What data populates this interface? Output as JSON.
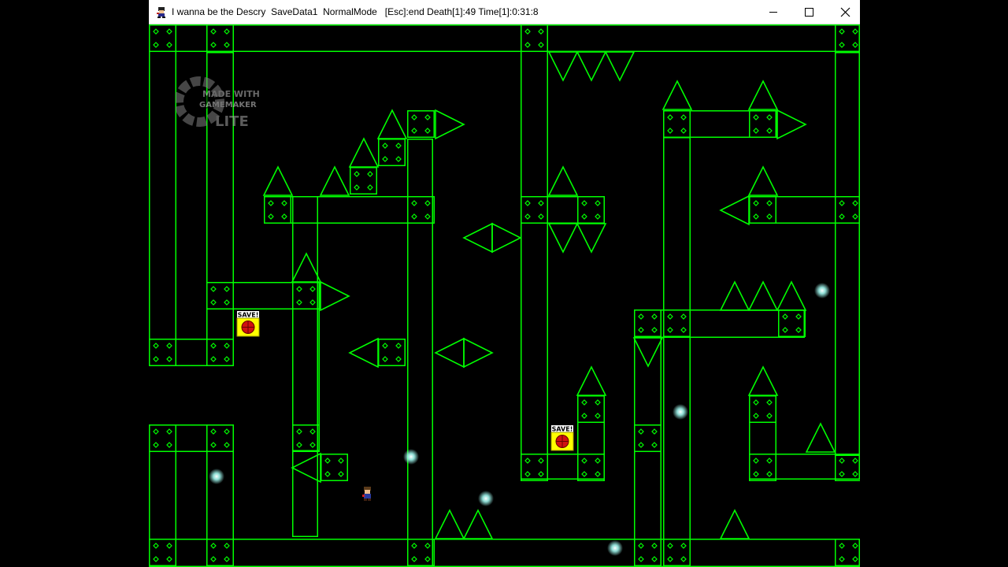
{
  "window": {
    "title": "I wanna be the Descry  SaveData1  NormalMode   [Esc]:end Death[1]:49 Time[1]:0:31:8",
    "controls": {
      "minimize": "minimize-icon",
      "maximize": "maximize-icon",
      "close": "close-icon"
    }
  },
  "watermark": {
    "line1": "MADE WITH",
    "line2": "GAMEMAKER",
    "line3": "LITE"
  },
  "save_points": [
    {
      "label": "SAVE!"
    },
    {
      "label": "SAVE!"
    }
  ],
  "colors": {
    "level_outline": "#00ff00",
    "background": "#000000",
    "orb": "#9ff7ee",
    "save_box": "#ffff00",
    "save_core": "#d01010"
  }
}
